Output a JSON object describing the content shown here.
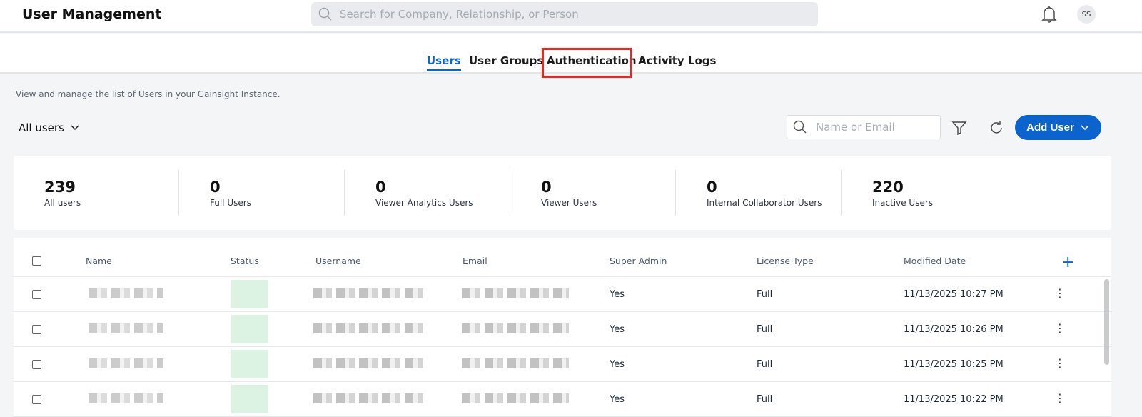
{
  "header": {
    "title": "User Management",
    "search_placeholder": "Search for Company, Relationship, or Person",
    "avatar": "SS"
  },
  "tabs": [
    {
      "label": "Users",
      "active": true
    },
    {
      "label": "User Groups"
    },
    {
      "label": "Authentication",
      "highlighted": true
    },
    {
      "label": "Activity Logs"
    }
  ],
  "description": "View and manage the list of Users in your Gainsight Instance.",
  "filter": {
    "view": "All users",
    "search_placeholder": "Name or Email",
    "add_label": "Add User"
  },
  "stats": [
    {
      "value": "239",
      "label": "All users"
    },
    {
      "value": "0",
      "label": "Full Users"
    },
    {
      "value": "0",
      "label": "Viewer Analytics Users"
    },
    {
      "value": "0",
      "label": "Viewer Users"
    },
    {
      "value": "0",
      "label": "Internal Collaborator Users"
    },
    {
      "value": "220",
      "label": "Inactive Users"
    }
  ],
  "table": {
    "columns": [
      "Name",
      "Status",
      "Username",
      "Email",
      "Super Admin",
      "License Type",
      "Modified Date"
    ],
    "rows": [
      {
        "super_admin": "Yes",
        "license": "Full",
        "modified": "11/13/2025 10:27 PM"
      },
      {
        "super_admin": "Yes",
        "license": "Full",
        "modified": "11/13/2025 10:26 PM"
      },
      {
        "super_admin": "Yes",
        "license": "Full",
        "modified": "11/13/2025 10:25 PM"
      },
      {
        "super_admin": "Yes",
        "license": "Full",
        "modified": "11/13/2025 10:22 PM"
      }
    ]
  },
  "colors": {
    "accent": "#0b63ce",
    "highlight": "#e8281e"
  }
}
